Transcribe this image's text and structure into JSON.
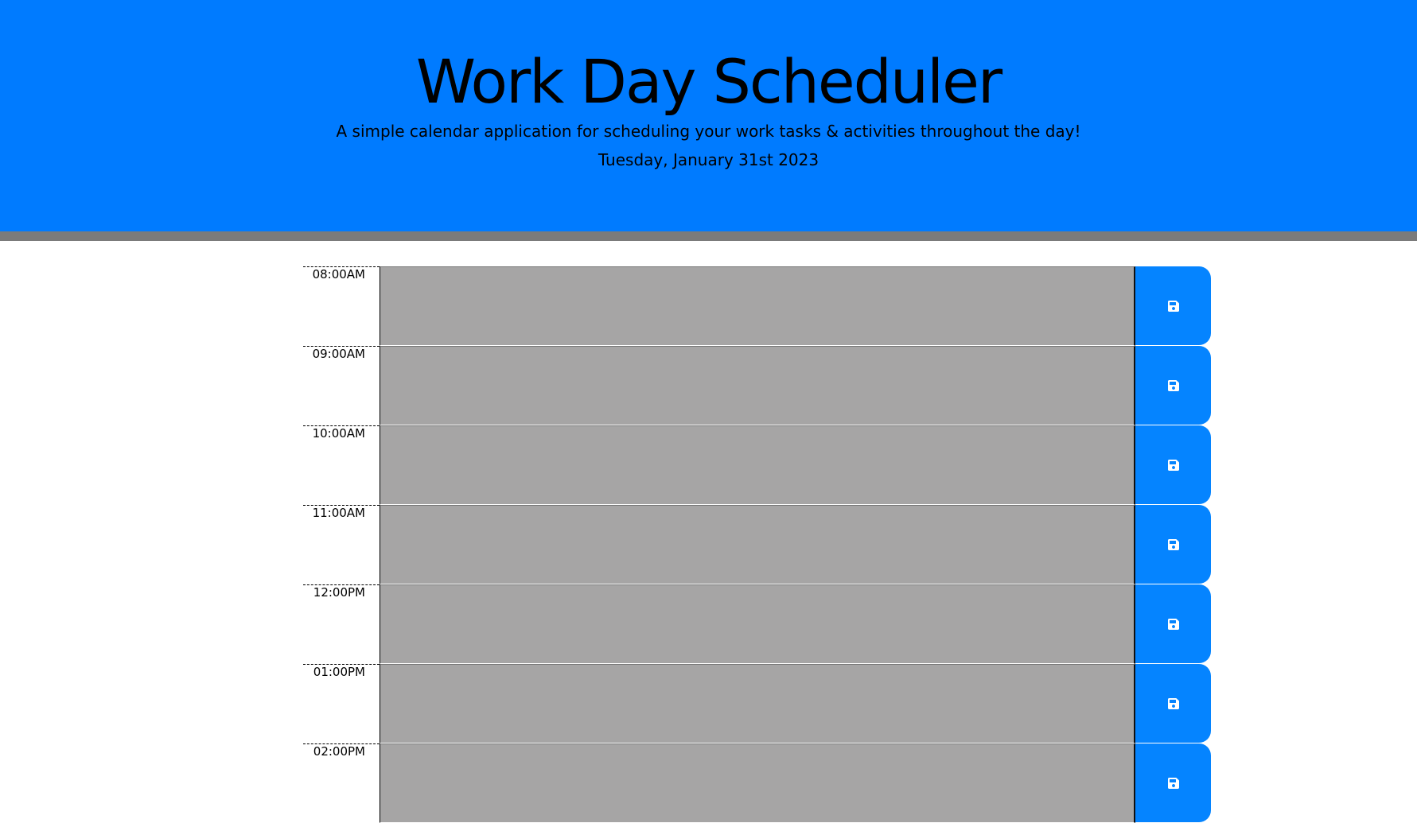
{
  "header": {
    "title": "Work Day Scheduler",
    "subtitle": "A simple calendar application for scheduling your work tasks & activities throughout the day!",
    "current_date": "Tuesday, January 31st 2023"
  },
  "colors": {
    "header_bg": "#007bff",
    "header_border": "#7b7b7b",
    "time_block_past": "#a6a5a5",
    "save_button": "#0584ff"
  },
  "time_blocks": [
    {
      "hour": "08:00AM",
      "text": "",
      "save_icon": "save-icon"
    },
    {
      "hour": "09:00AM",
      "text": "",
      "save_icon": "save-icon"
    },
    {
      "hour": "10:00AM",
      "text": "",
      "save_icon": "save-icon"
    },
    {
      "hour": "11:00AM",
      "text": "",
      "save_icon": "save-icon"
    },
    {
      "hour": "12:00PM",
      "text": "",
      "save_icon": "save-icon"
    },
    {
      "hour": "01:00PM",
      "text": "",
      "save_icon": "save-icon"
    },
    {
      "hour": "02:00PM",
      "text": "",
      "save_icon": "save-icon"
    }
  ]
}
